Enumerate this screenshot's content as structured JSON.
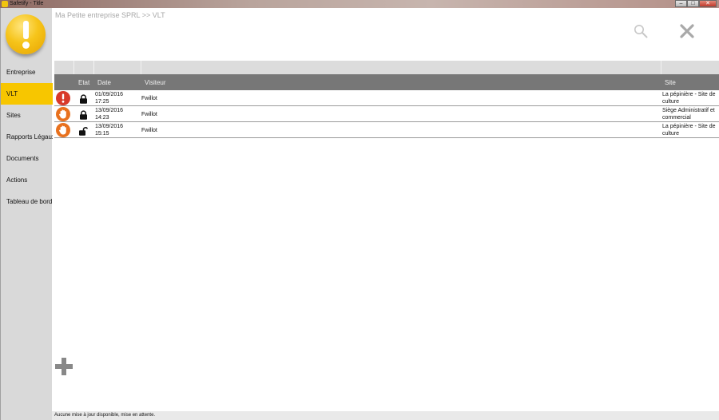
{
  "window": {
    "title": "Safetify - Title",
    "min": "–",
    "max": "□",
    "close": "✕"
  },
  "sidebar": {
    "items": [
      {
        "label": "Entreprise",
        "active": false
      },
      {
        "label": "VLT",
        "active": true
      },
      {
        "label": "Sites",
        "active": false
      },
      {
        "label": "Rapports Légaux",
        "active": false
      },
      {
        "label": "Documents",
        "active": false
      },
      {
        "label": "Actions",
        "active": false
      },
      {
        "label": "Tableau de bord",
        "active": false
      }
    ]
  },
  "breadcrumb": "Ma Petite entreprise SPRL >> VLT",
  "table": {
    "columns": {
      "etat": "Etat",
      "date": "Date",
      "visiteur": "Visiteur",
      "site": "Site"
    },
    "rows": [
      {
        "status_icon": "alert-icon",
        "lock_icon": "lock-closed-icon",
        "date": "01/09/2016",
        "time": "17:25",
        "visiteur": "Fwillot",
        "site": "La pépinière - Site de culture"
      },
      {
        "status_icon": "hand-stop-icon",
        "lock_icon": "lock-closed-icon",
        "date": "13/09/2016",
        "time": "14:23",
        "visiteur": "Fwillot",
        "site": "Siège Administratif et commercial"
      },
      {
        "status_icon": "hand-stop-icon",
        "lock_icon": "lock-open-icon",
        "date": "13/09/2016",
        "time": "15:15",
        "visiteur": "Fwillot",
        "site": "La pépinière - Site de culture"
      }
    ]
  },
  "statusbar": "Aucune mise à jour disponible, mise en attente.",
  "colors": {
    "accent": "#f7c600",
    "alert": "#d83a2a",
    "warning": "#e8711e",
    "header": "#777777"
  }
}
